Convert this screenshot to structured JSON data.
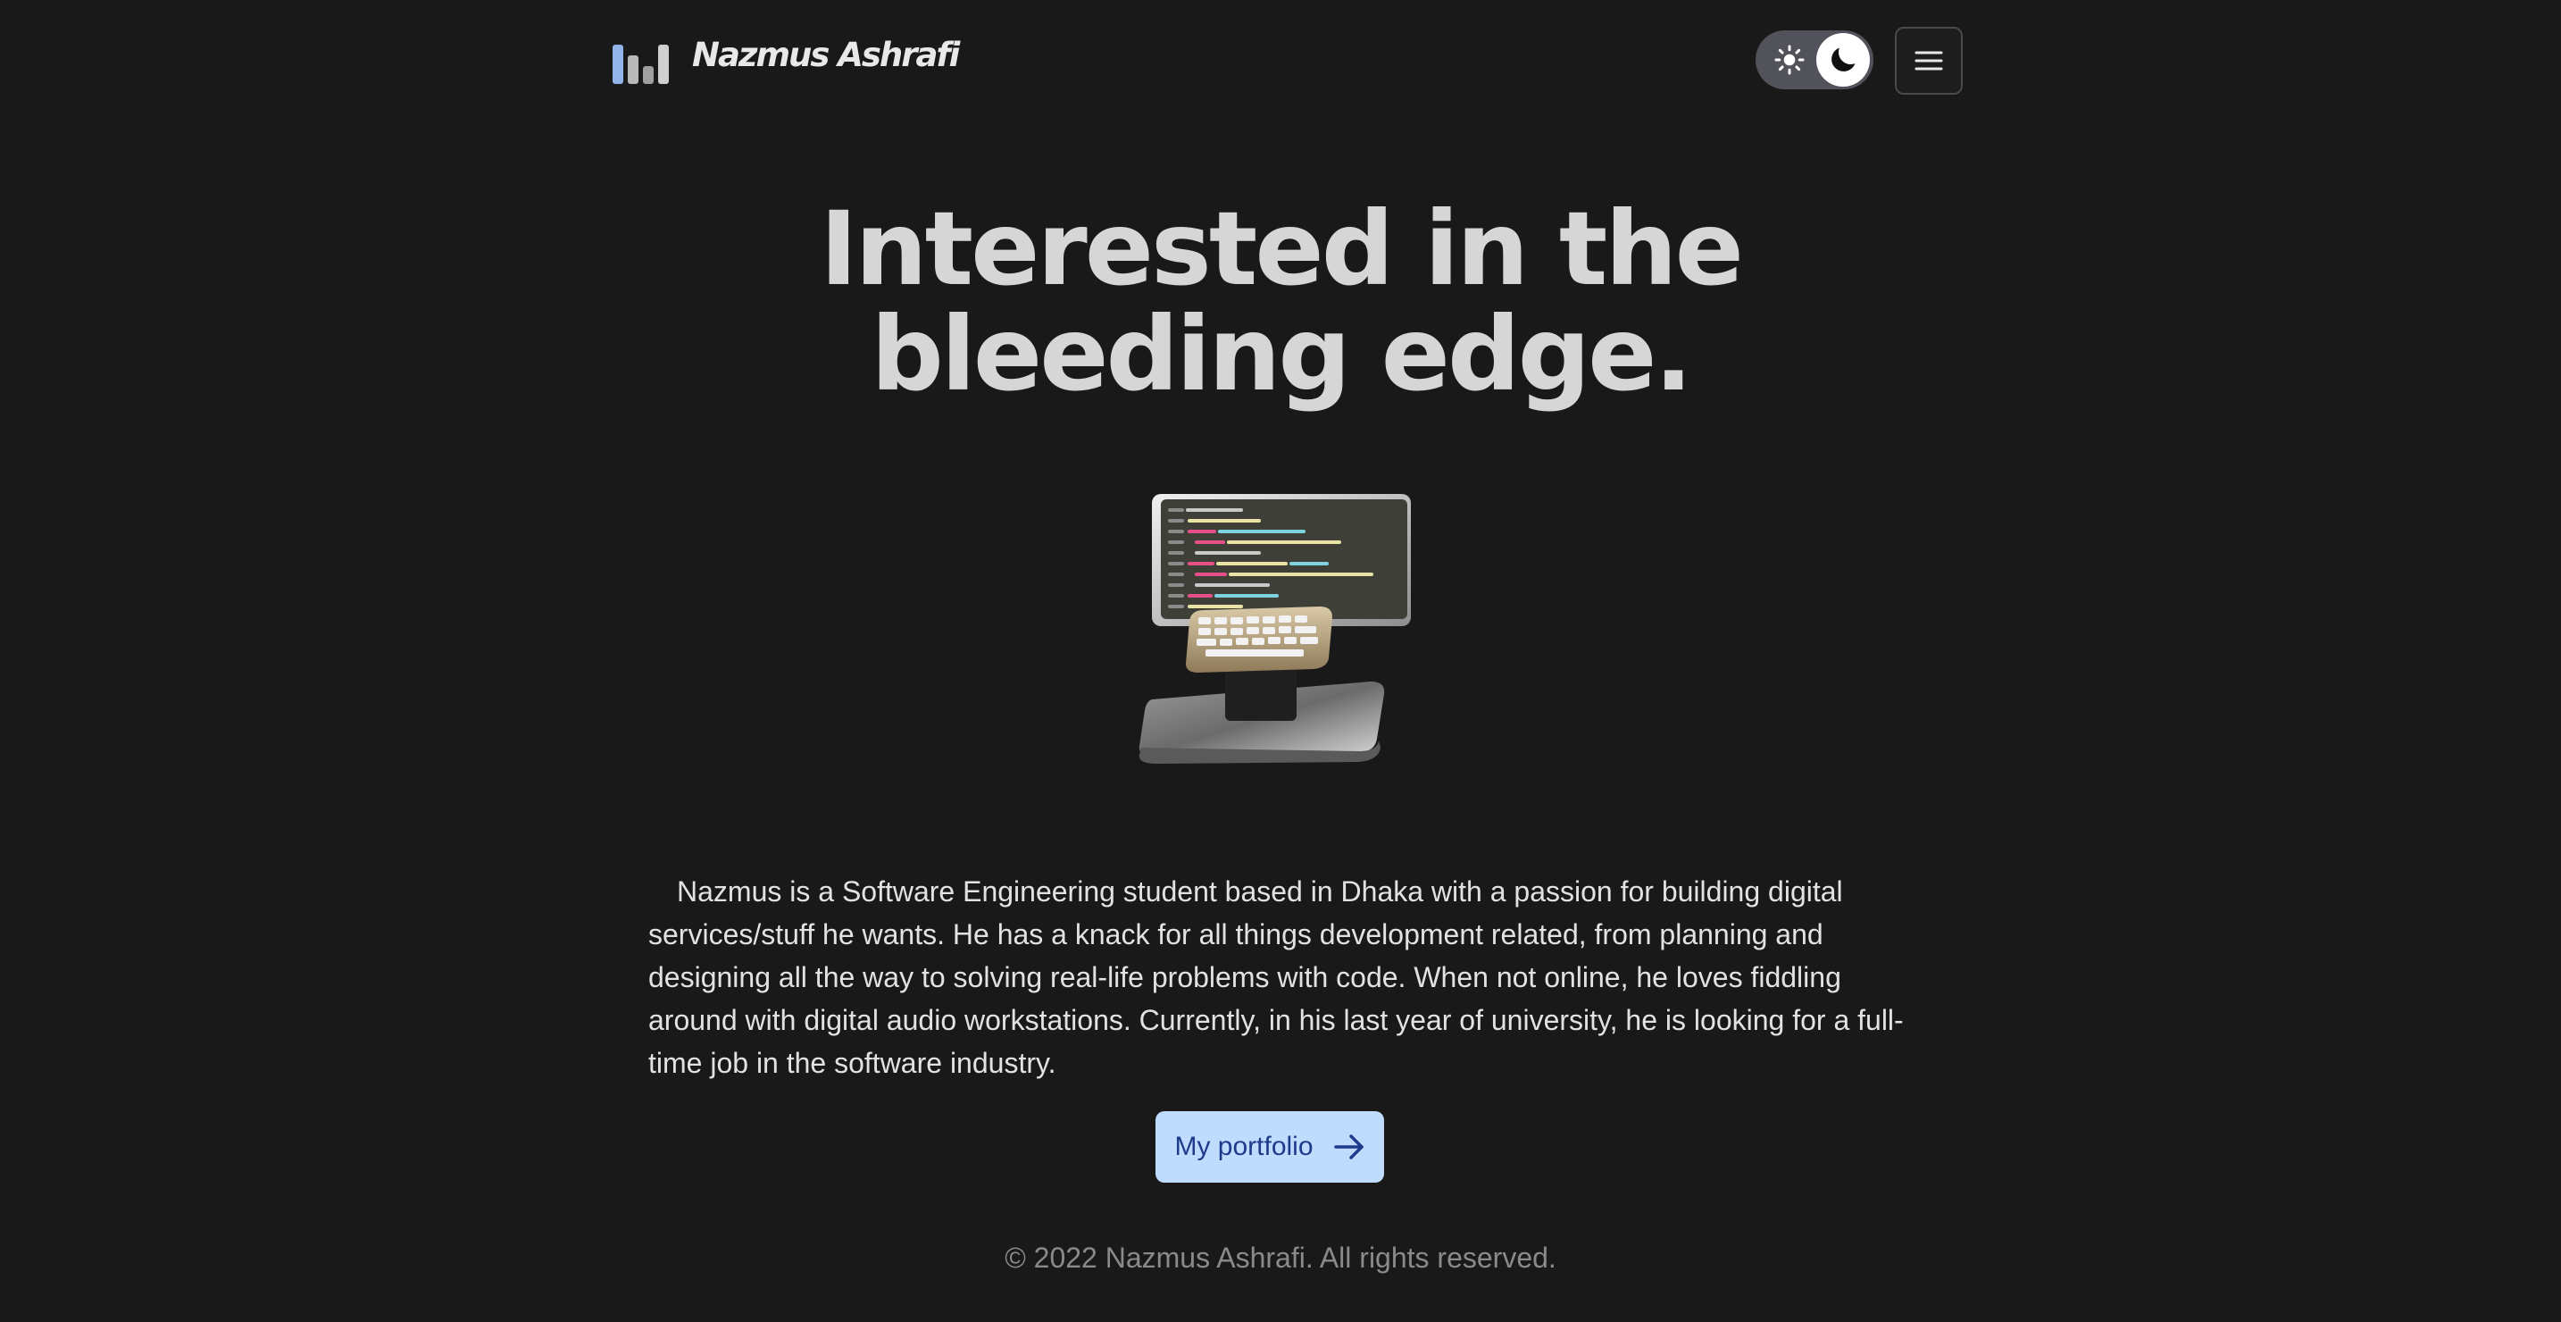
{
  "header": {
    "brand_name": "Nazmus Ashrafi",
    "logo_bar_colors": [
      "#93b4e8",
      "#b9b9b9",
      "#9f9f9f",
      "#cfcfcf"
    ],
    "theme_toggle": {
      "mode": "dark",
      "off_icon": "sun-icon",
      "on_icon": "moon-icon"
    },
    "menu_icon": "hamburger-icon"
  },
  "hero": {
    "title_line1": "Interested in the",
    "title_line2": "bleeding edge.",
    "illustration": "computer-workstation-illustration"
  },
  "about": {
    "bio": "Nazmus is a Software Engineering student based in Dhaka with a passion for building digital services/stuff he wants. He has a knack for all things development related, from planning and designing all the way to solving real-life problems with code. When not online, he loves fiddling around with digital audio workstations. Currently, in his last year of university, he is looking for a full-time job in the software industry."
  },
  "cta": {
    "label": "My portfolio",
    "icon": "arrow-right-icon",
    "background": "#bfdbfe",
    "text_color": "#1e3a8a"
  },
  "footer": {
    "copyright": "© 2022 Nazmus Ashrafi. All rights reserved."
  },
  "colors": {
    "background": "#191919",
    "text": "#e6e6e6",
    "muted": "#8a8a8a"
  }
}
